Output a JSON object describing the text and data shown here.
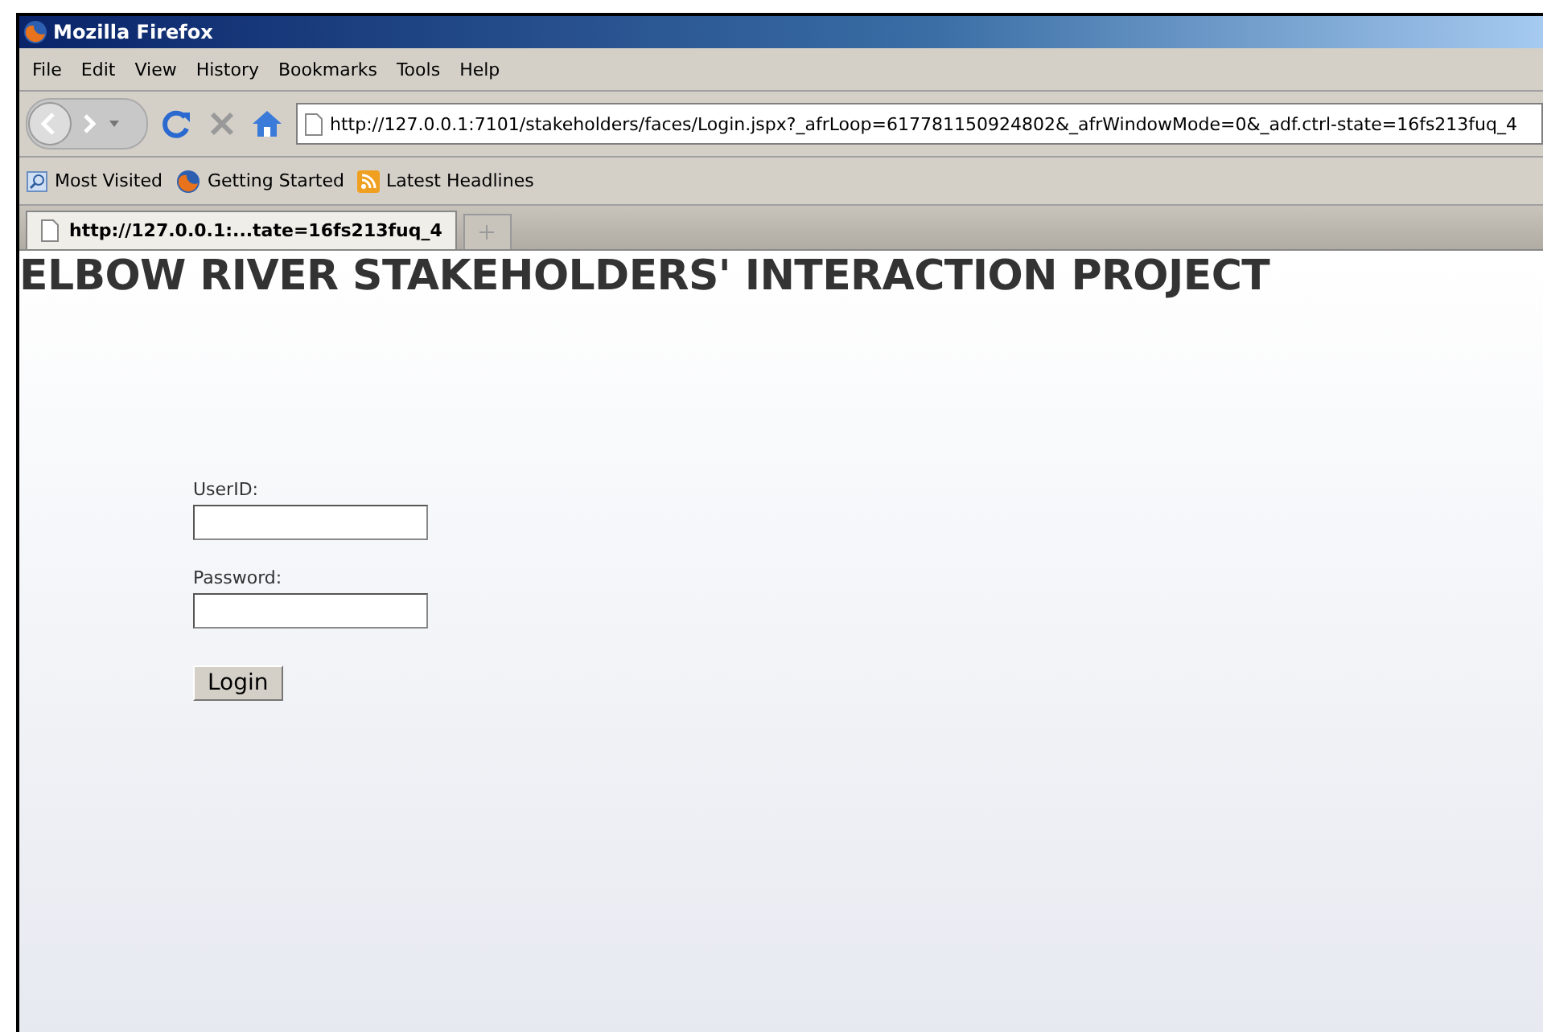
{
  "window": {
    "title": "Mozilla Firefox"
  },
  "menu": [
    "File",
    "Edit",
    "View",
    "History",
    "Bookmarks",
    "Tools",
    "Help"
  ],
  "address": {
    "value": "http://127.0.0.1:7101/stakeholders/faces/Login.jspx?_afrLoop=617781150924802&_afrWindowMode=0&_adf.ctrl-state=16fs213fuq_4"
  },
  "bookmarks": [
    {
      "label": "Most Visited",
      "kind": "search"
    },
    {
      "label": "Getting Started",
      "kind": "firefox"
    },
    {
      "label": "Latest Headlines",
      "kind": "rss"
    }
  ],
  "tabs": [
    {
      "label": "http://127.0.0.1:...tate=16fs213fuq_4",
      "selected": true
    }
  ],
  "page": {
    "heading": "ELBOW RIVER STAKEHOLDERS' INTERACTION PROJECT",
    "fields": [
      {
        "label": "UserID:"
      },
      {
        "label": "Password:"
      }
    ],
    "button": "Login"
  }
}
